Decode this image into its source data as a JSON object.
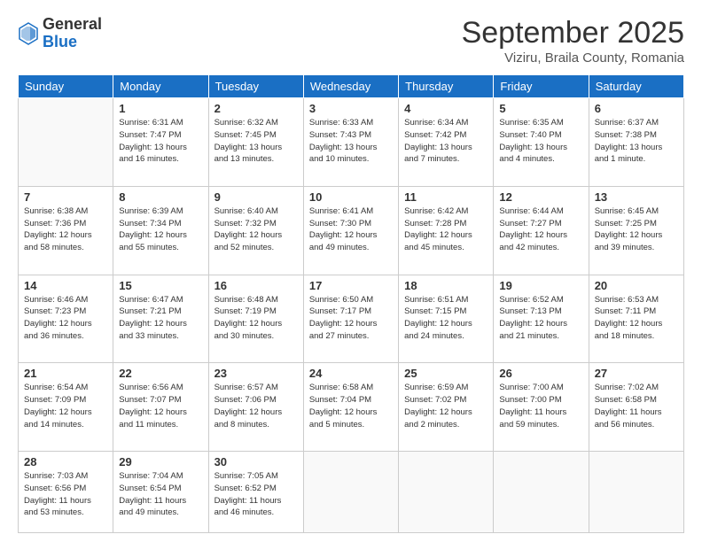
{
  "logo": {
    "general": "General",
    "blue": "Blue"
  },
  "header": {
    "month": "September 2025",
    "location": "Viziru, Braila County, Romania"
  },
  "weekdays": [
    "Sunday",
    "Monday",
    "Tuesday",
    "Wednesday",
    "Thursday",
    "Friday",
    "Saturday"
  ],
  "weeks": [
    [
      {
        "day": "",
        "info": ""
      },
      {
        "day": "1",
        "info": "Sunrise: 6:31 AM\nSunset: 7:47 PM\nDaylight: 13 hours\nand 16 minutes."
      },
      {
        "day": "2",
        "info": "Sunrise: 6:32 AM\nSunset: 7:45 PM\nDaylight: 13 hours\nand 13 minutes."
      },
      {
        "day": "3",
        "info": "Sunrise: 6:33 AM\nSunset: 7:43 PM\nDaylight: 13 hours\nand 10 minutes."
      },
      {
        "day": "4",
        "info": "Sunrise: 6:34 AM\nSunset: 7:42 PM\nDaylight: 13 hours\nand 7 minutes."
      },
      {
        "day": "5",
        "info": "Sunrise: 6:35 AM\nSunset: 7:40 PM\nDaylight: 13 hours\nand 4 minutes."
      },
      {
        "day": "6",
        "info": "Sunrise: 6:37 AM\nSunset: 7:38 PM\nDaylight: 13 hours\nand 1 minute."
      }
    ],
    [
      {
        "day": "7",
        "info": "Sunrise: 6:38 AM\nSunset: 7:36 PM\nDaylight: 12 hours\nand 58 minutes."
      },
      {
        "day": "8",
        "info": "Sunrise: 6:39 AM\nSunset: 7:34 PM\nDaylight: 12 hours\nand 55 minutes."
      },
      {
        "day": "9",
        "info": "Sunrise: 6:40 AM\nSunset: 7:32 PM\nDaylight: 12 hours\nand 52 minutes."
      },
      {
        "day": "10",
        "info": "Sunrise: 6:41 AM\nSunset: 7:30 PM\nDaylight: 12 hours\nand 49 minutes."
      },
      {
        "day": "11",
        "info": "Sunrise: 6:42 AM\nSunset: 7:28 PM\nDaylight: 12 hours\nand 45 minutes."
      },
      {
        "day": "12",
        "info": "Sunrise: 6:44 AM\nSunset: 7:27 PM\nDaylight: 12 hours\nand 42 minutes."
      },
      {
        "day": "13",
        "info": "Sunrise: 6:45 AM\nSunset: 7:25 PM\nDaylight: 12 hours\nand 39 minutes."
      }
    ],
    [
      {
        "day": "14",
        "info": "Sunrise: 6:46 AM\nSunset: 7:23 PM\nDaylight: 12 hours\nand 36 minutes."
      },
      {
        "day": "15",
        "info": "Sunrise: 6:47 AM\nSunset: 7:21 PM\nDaylight: 12 hours\nand 33 minutes."
      },
      {
        "day": "16",
        "info": "Sunrise: 6:48 AM\nSunset: 7:19 PM\nDaylight: 12 hours\nand 30 minutes."
      },
      {
        "day": "17",
        "info": "Sunrise: 6:50 AM\nSunset: 7:17 PM\nDaylight: 12 hours\nand 27 minutes."
      },
      {
        "day": "18",
        "info": "Sunrise: 6:51 AM\nSunset: 7:15 PM\nDaylight: 12 hours\nand 24 minutes."
      },
      {
        "day": "19",
        "info": "Sunrise: 6:52 AM\nSunset: 7:13 PM\nDaylight: 12 hours\nand 21 minutes."
      },
      {
        "day": "20",
        "info": "Sunrise: 6:53 AM\nSunset: 7:11 PM\nDaylight: 12 hours\nand 18 minutes."
      }
    ],
    [
      {
        "day": "21",
        "info": "Sunrise: 6:54 AM\nSunset: 7:09 PM\nDaylight: 12 hours\nand 14 minutes."
      },
      {
        "day": "22",
        "info": "Sunrise: 6:56 AM\nSunset: 7:07 PM\nDaylight: 12 hours\nand 11 minutes."
      },
      {
        "day": "23",
        "info": "Sunrise: 6:57 AM\nSunset: 7:06 PM\nDaylight: 12 hours\nand 8 minutes."
      },
      {
        "day": "24",
        "info": "Sunrise: 6:58 AM\nSunset: 7:04 PM\nDaylight: 12 hours\nand 5 minutes."
      },
      {
        "day": "25",
        "info": "Sunrise: 6:59 AM\nSunset: 7:02 PM\nDaylight: 12 hours\nand 2 minutes."
      },
      {
        "day": "26",
        "info": "Sunrise: 7:00 AM\nSunset: 7:00 PM\nDaylight: 11 hours\nand 59 minutes."
      },
      {
        "day": "27",
        "info": "Sunrise: 7:02 AM\nSunset: 6:58 PM\nDaylight: 11 hours\nand 56 minutes."
      }
    ],
    [
      {
        "day": "28",
        "info": "Sunrise: 7:03 AM\nSunset: 6:56 PM\nDaylight: 11 hours\nand 53 minutes."
      },
      {
        "day": "29",
        "info": "Sunrise: 7:04 AM\nSunset: 6:54 PM\nDaylight: 11 hours\nand 49 minutes."
      },
      {
        "day": "30",
        "info": "Sunrise: 7:05 AM\nSunset: 6:52 PM\nDaylight: 11 hours\nand 46 minutes."
      },
      {
        "day": "",
        "info": ""
      },
      {
        "day": "",
        "info": ""
      },
      {
        "day": "",
        "info": ""
      },
      {
        "day": "",
        "info": ""
      }
    ]
  ]
}
